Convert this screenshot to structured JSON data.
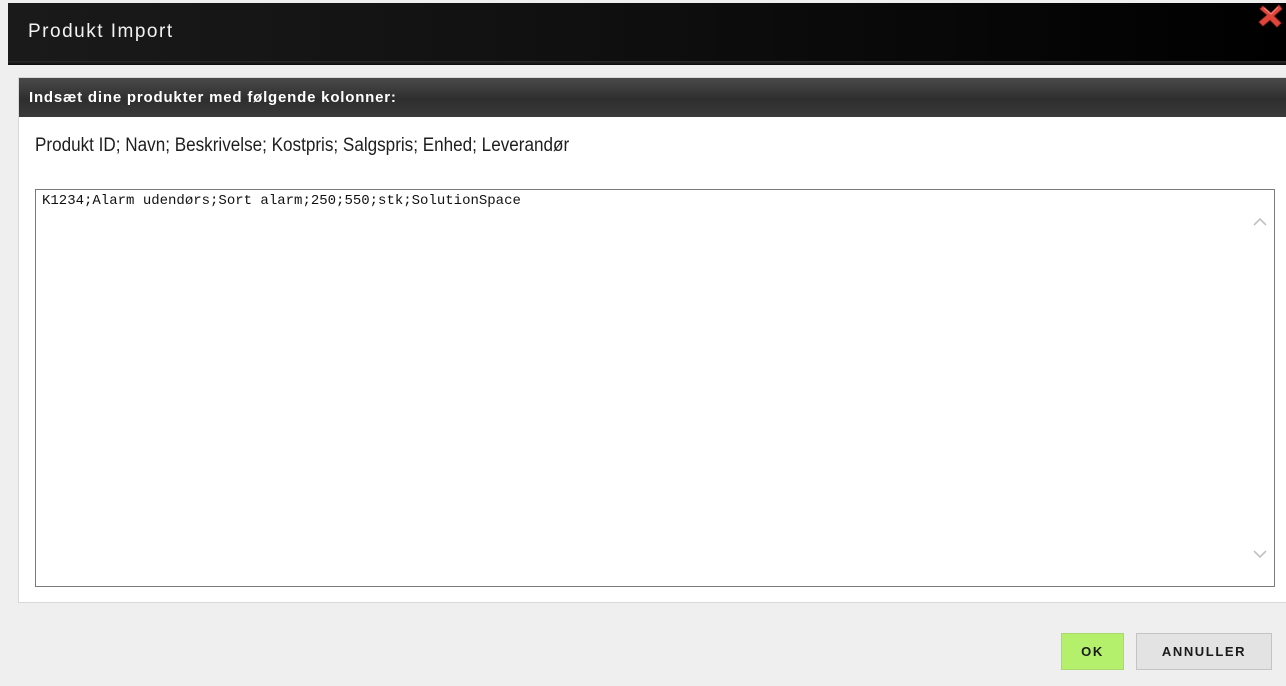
{
  "window": {
    "title": "Produkt Import",
    "close_icon": "close-x-icon",
    "close_color": "#e0443a"
  },
  "panel": {
    "header": "Indsæt dine produkter med følgende kolonner:",
    "columns_hint": "Produkt ID; Navn; Beskrivelse; Kostpris; Salgspris; Enhed; Leverandør",
    "textarea_value": "K1234;Alarm udendørs;Sort alarm;250;550;stk;SolutionSpace"
  },
  "buttons": {
    "ok_label": "OK",
    "cancel_label": "ANNULLER",
    "ok_color": "#b4f06c"
  }
}
